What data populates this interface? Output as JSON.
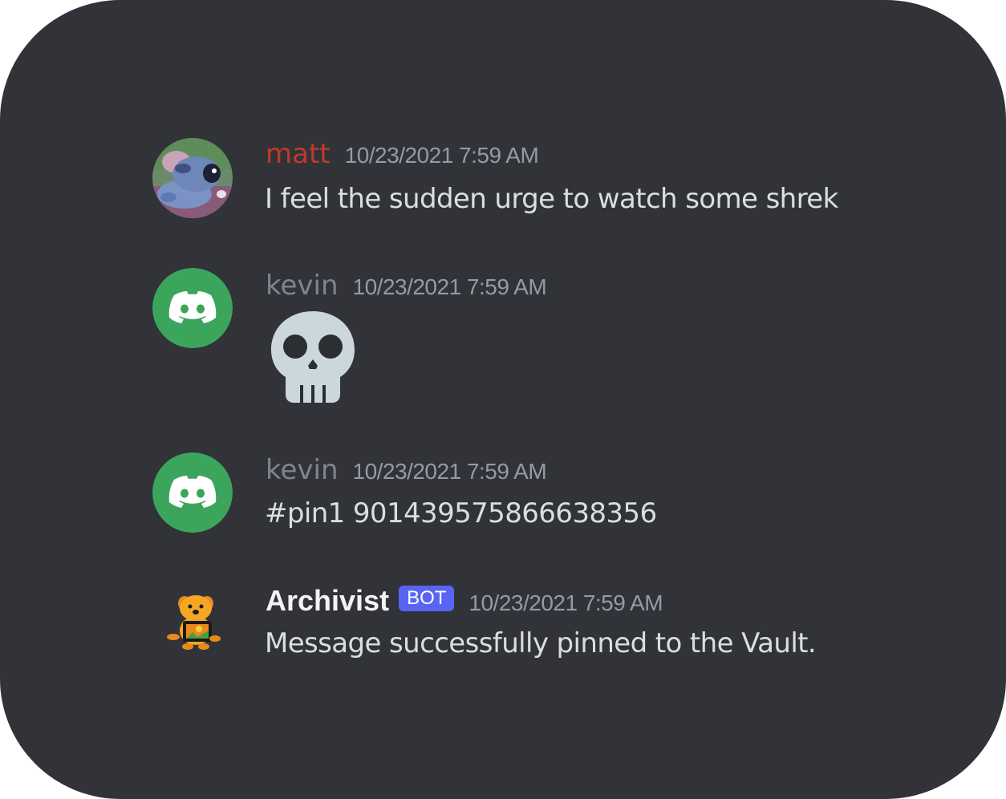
{
  "colors": {
    "background": "#313338",
    "matt_name": "#c0392b",
    "kevin_name": "#80848e",
    "archivist_name": "#f2f3f5",
    "timestamp": "#949ba4",
    "message_text": "#dbdee1",
    "discord_green": "#3ba55c",
    "bot_tag": "#5865f2"
  },
  "messages": [
    {
      "author": "matt",
      "timestamp": "10/23/2021 7:59 AM",
      "content": "I feel the sudden urge to watch some shrek",
      "avatar": "stitch-sleeping-avatar"
    },
    {
      "author": "kevin",
      "timestamp": "10/23/2021 7:59 AM",
      "content": "",
      "emoji": "skull-emoji",
      "avatar": "discord-default-avatar"
    },
    {
      "author": "kevin",
      "timestamp": "10/23/2021 7:59 AM",
      "content": "#pin1 901439575866638356",
      "avatar": "discord-default-avatar"
    },
    {
      "author": "Archivist",
      "tag": "BOT",
      "timestamp": "10/23/2021 7:59 AM",
      "content": "Message successfully pinned to the Vault.",
      "avatar": "archivist-dog-avatar"
    }
  ]
}
